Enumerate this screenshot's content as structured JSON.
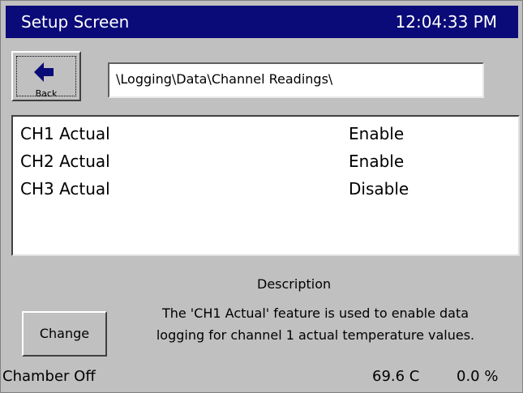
{
  "header": {
    "title": "Setup Screen",
    "time": "12:04:33 PM"
  },
  "back_button": {
    "label": "Back",
    "icon": "left-arrow-icon"
  },
  "path": "\\Logging\\Data\\Channel Readings\\",
  "settings": [
    {
      "name": "CH1 Actual",
      "value": "Enable"
    },
    {
      "name": "CH2 Actual",
      "value": "Enable"
    },
    {
      "name": "CH3 Actual",
      "value": "Disable"
    }
  ],
  "description": {
    "title": "Description",
    "line1": "The 'CH1 Actual' feature is used to enable data",
    "line2": "logging for channel 1 actual temperature values."
  },
  "change_button": {
    "label": "Change"
  },
  "status": {
    "chamber": "Chamber Off",
    "temperature": "69.6 C",
    "percent": "0.0 %"
  },
  "colors": {
    "titlebar_bg": "#0a0a78",
    "panel_bg": "#c0c0c0",
    "arrow": "#0a0a78"
  }
}
